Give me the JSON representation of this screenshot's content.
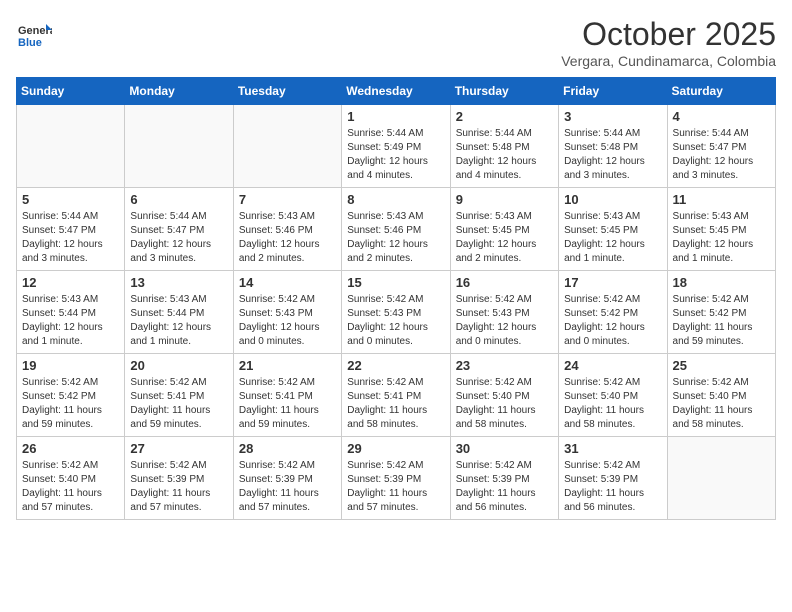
{
  "header": {
    "logo_general": "General",
    "logo_blue": "Blue",
    "month_title": "October 2025",
    "subtitle": "Vergara, Cundinamarca, Colombia"
  },
  "weekdays": [
    "Sunday",
    "Monday",
    "Tuesday",
    "Wednesday",
    "Thursday",
    "Friday",
    "Saturday"
  ],
  "weeks": [
    [
      {
        "day": "",
        "info": ""
      },
      {
        "day": "",
        "info": ""
      },
      {
        "day": "",
        "info": ""
      },
      {
        "day": "1",
        "info": "Sunrise: 5:44 AM\nSunset: 5:49 PM\nDaylight: 12 hours\nand 4 minutes."
      },
      {
        "day": "2",
        "info": "Sunrise: 5:44 AM\nSunset: 5:48 PM\nDaylight: 12 hours\nand 4 minutes."
      },
      {
        "day": "3",
        "info": "Sunrise: 5:44 AM\nSunset: 5:48 PM\nDaylight: 12 hours\nand 3 minutes."
      },
      {
        "day": "4",
        "info": "Sunrise: 5:44 AM\nSunset: 5:47 PM\nDaylight: 12 hours\nand 3 minutes."
      }
    ],
    [
      {
        "day": "5",
        "info": "Sunrise: 5:44 AM\nSunset: 5:47 PM\nDaylight: 12 hours\nand 3 minutes."
      },
      {
        "day": "6",
        "info": "Sunrise: 5:44 AM\nSunset: 5:47 PM\nDaylight: 12 hours\nand 3 minutes."
      },
      {
        "day": "7",
        "info": "Sunrise: 5:43 AM\nSunset: 5:46 PM\nDaylight: 12 hours\nand 2 minutes."
      },
      {
        "day": "8",
        "info": "Sunrise: 5:43 AM\nSunset: 5:46 PM\nDaylight: 12 hours\nand 2 minutes."
      },
      {
        "day": "9",
        "info": "Sunrise: 5:43 AM\nSunset: 5:45 PM\nDaylight: 12 hours\nand 2 minutes."
      },
      {
        "day": "10",
        "info": "Sunrise: 5:43 AM\nSunset: 5:45 PM\nDaylight: 12 hours\nand 1 minute."
      },
      {
        "day": "11",
        "info": "Sunrise: 5:43 AM\nSunset: 5:45 PM\nDaylight: 12 hours\nand 1 minute."
      }
    ],
    [
      {
        "day": "12",
        "info": "Sunrise: 5:43 AM\nSunset: 5:44 PM\nDaylight: 12 hours\nand 1 minute."
      },
      {
        "day": "13",
        "info": "Sunrise: 5:43 AM\nSunset: 5:44 PM\nDaylight: 12 hours\nand 1 minute."
      },
      {
        "day": "14",
        "info": "Sunrise: 5:42 AM\nSunset: 5:43 PM\nDaylight: 12 hours\nand 0 minutes."
      },
      {
        "day": "15",
        "info": "Sunrise: 5:42 AM\nSunset: 5:43 PM\nDaylight: 12 hours\nand 0 minutes."
      },
      {
        "day": "16",
        "info": "Sunrise: 5:42 AM\nSunset: 5:43 PM\nDaylight: 12 hours\nand 0 minutes."
      },
      {
        "day": "17",
        "info": "Sunrise: 5:42 AM\nSunset: 5:42 PM\nDaylight: 12 hours\nand 0 minutes."
      },
      {
        "day": "18",
        "info": "Sunrise: 5:42 AM\nSunset: 5:42 PM\nDaylight: 11 hours\nand 59 minutes."
      }
    ],
    [
      {
        "day": "19",
        "info": "Sunrise: 5:42 AM\nSunset: 5:42 PM\nDaylight: 11 hours\nand 59 minutes."
      },
      {
        "day": "20",
        "info": "Sunrise: 5:42 AM\nSunset: 5:41 PM\nDaylight: 11 hours\nand 59 minutes."
      },
      {
        "day": "21",
        "info": "Sunrise: 5:42 AM\nSunset: 5:41 PM\nDaylight: 11 hours\nand 59 minutes."
      },
      {
        "day": "22",
        "info": "Sunrise: 5:42 AM\nSunset: 5:41 PM\nDaylight: 11 hours\nand 58 minutes."
      },
      {
        "day": "23",
        "info": "Sunrise: 5:42 AM\nSunset: 5:40 PM\nDaylight: 11 hours\nand 58 minutes."
      },
      {
        "day": "24",
        "info": "Sunrise: 5:42 AM\nSunset: 5:40 PM\nDaylight: 11 hours\nand 58 minutes."
      },
      {
        "day": "25",
        "info": "Sunrise: 5:42 AM\nSunset: 5:40 PM\nDaylight: 11 hours\nand 58 minutes."
      }
    ],
    [
      {
        "day": "26",
        "info": "Sunrise: 5:42 AM\nSunset: 5:40 PM\nDaylight: 11 hours\nand 57 minutes."
      },
      {
        "day": "27",
        "info": "Sunrise: 5:42 AM\nSunset: 5:39 PM\nDaylight: 11 hours\nand 57 minutes."
      },
      {
        "day": "28",
        "info": "Sunrise: 5:42 AM\nSunset: 5:39 PM\nDaylight: 11 hours\nand 57 minutes."
      },
      {
        "day": "29",
        "info": "Sunrise: 5:42 AM\nSunset: 5:39 PM\nDaylight: 11 hours\nand 57 minutes."
      },
      {
        "day": "30",
        "info": "Sunrise: 5:42 AM\nSunset: 5:39 PM\nDaylight: 11 hours\nand 56 minutes."
      },
      {
        "day": "31",
        "info": "Sunrise: 5:42 AM\nSunset: 5:39 PM\nDaylight: 11 hours\nand 56 minutes."
      },
      {
        "day": "",
        "info": ""
      }
    ]
  ]
}
